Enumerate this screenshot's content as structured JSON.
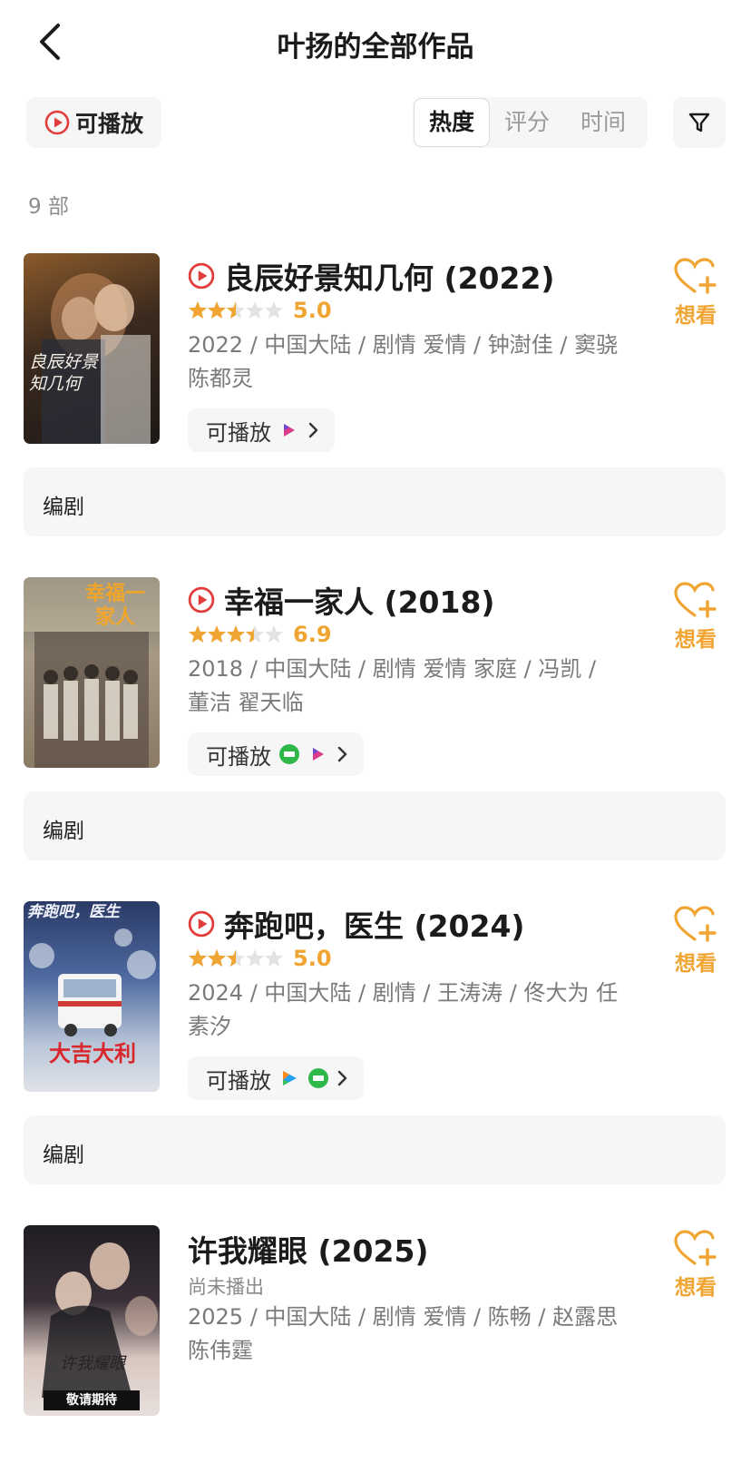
{
  "header": {
    "title": "叶扬的全部作品"
  },
  "filters": {
    "playable_label": "可播放",
    "sort_tabs": [
      "热度",
      "评分",
      "时间"
    ],
    "active_sort": "热度"
  },
  "count_text": "9 部",
  "colors": {
    "accent": "#f0a431",
    "play_red": "#e23d3d",
    "panel_bg": "#f6f6f6"
  },
  "works": [
    {
      "title": "良辰好景知几何 (2022)",
      "has_play_icon": true,
      "rating": 5.0,
      "rating_text": "5.0",
      "meta": "2022 / 中国大陆 / 剧情 爱情 / 钟澍佳 / 窦骁 陈都灵",
      "play_label": "可播放",
      "platforms": [
        "mango-tv-icon"
      ],
      "want_label": "想看",
      "role": "编剧",
      "poster_text": "良辰好景知几何"
    },
    {
      "title": "幸福一家人 (2018)",
      "has_play_icon": true,
      "rating": 6.9,
      "rating_text": "6.9",
      "meta": "2018 / 中国大陆 / 剧情 爱情 家庭 / 冯凯 / 董洁 翟天临",
      "play_label": "可播放",
      "platforms": [
        "iqiyi-icon",
        "mango-tv-icon"
      ],
      "want_label": "想看",
      "role": "编剧",
      "poster_text": "幸福一家人"
    },
    {
      "title": "奔跑吧，医生 (2024)",
      "has_play_icon": true,
      "rating": 5.0,
      "rating_text": "5.0",
      "meta": "2024 / 中国大陆 / 剧情 / 王涛涛 / 佟大为 任素汐",
      "play_label": "可播放",
      "platforms": [
        "tencent-video-icon",
        "iqiyi-icon"
      ],
      "want_label": "想看",
      "role": "编剧",
      "poster_text": "奔跑吧，医生",
      "poster_subtext": "大吉大利"
    },
    {
      "title": "许我耀眼 (2025)",
      "has_play_icon": false,
      "status": "尚未播出",
      "meta": "2025 / 中国大陆 / 剧情 爱情 / 陈畅 / 赵露思 陈伟霆",
      "want_label": "想看",
      "poster_text": "许我耀眼",
      "poster_badge": "敬请期待"
    }
  ]
}
